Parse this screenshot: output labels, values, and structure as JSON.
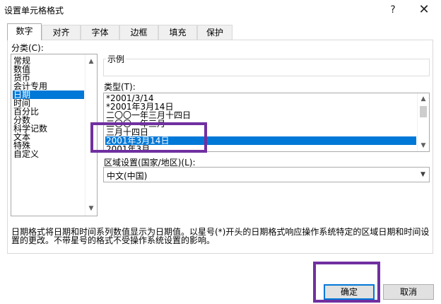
{
  "window": {
    "title": "设置单元格格式",
    "help": "?",
    "close": "✕"
  },
  "tabs": [
    "数字",
    "对齐",
    "字体",
    "边框",
    "填充",
    "保护"
  ],
  "category": {
    "label": "分类(C):",
    "items": [
      "常规",
      "数值",
      "货币",
      "会计专用",
      "日期",
      "时间",
      "百分比",
      "分数",
      "科学记数",
      "文本",
      "特殊",
      "自定义"
    ],
    "selected": "日期"
  },
  "sample": {
    "label": "示例"
  },
  "type": {
    "label": "类型(T):",
    "items": [
      "*2001/3/14",
      "*2001年3月14日",
      "二〇〇一年三月十四日",
      "二〇〇一年三月",
      "三月十四日",
      "2001年3月14日",
      "2001年3月"
    ],
    "selected": "2001年3月14日"
  },
  "locale": {
    "label": "区域设置(国家/地区)(L):",
    "value": "中文(中国)"
  },
  "description": "日期格式将日期和时间系列数值显示为日期值。以星号(*)开头的日期格式响应操作系统特定的区域日期和时间设置的更改。不带星号的格式不受操作系统设置的影响。",
  "buttons": {
    "ok": "确定",
    "cancel": "取消"
  },
  "colors": {
    "selection": "#0078d7",
    "highlight": "#7030a0",
    "default_button_border": "#0078d7"
  },
  "icons": {
    "scroll_up": "▲",
    "scroll_down": "▼",
    "combo_arrow": "▼"
  }
}
